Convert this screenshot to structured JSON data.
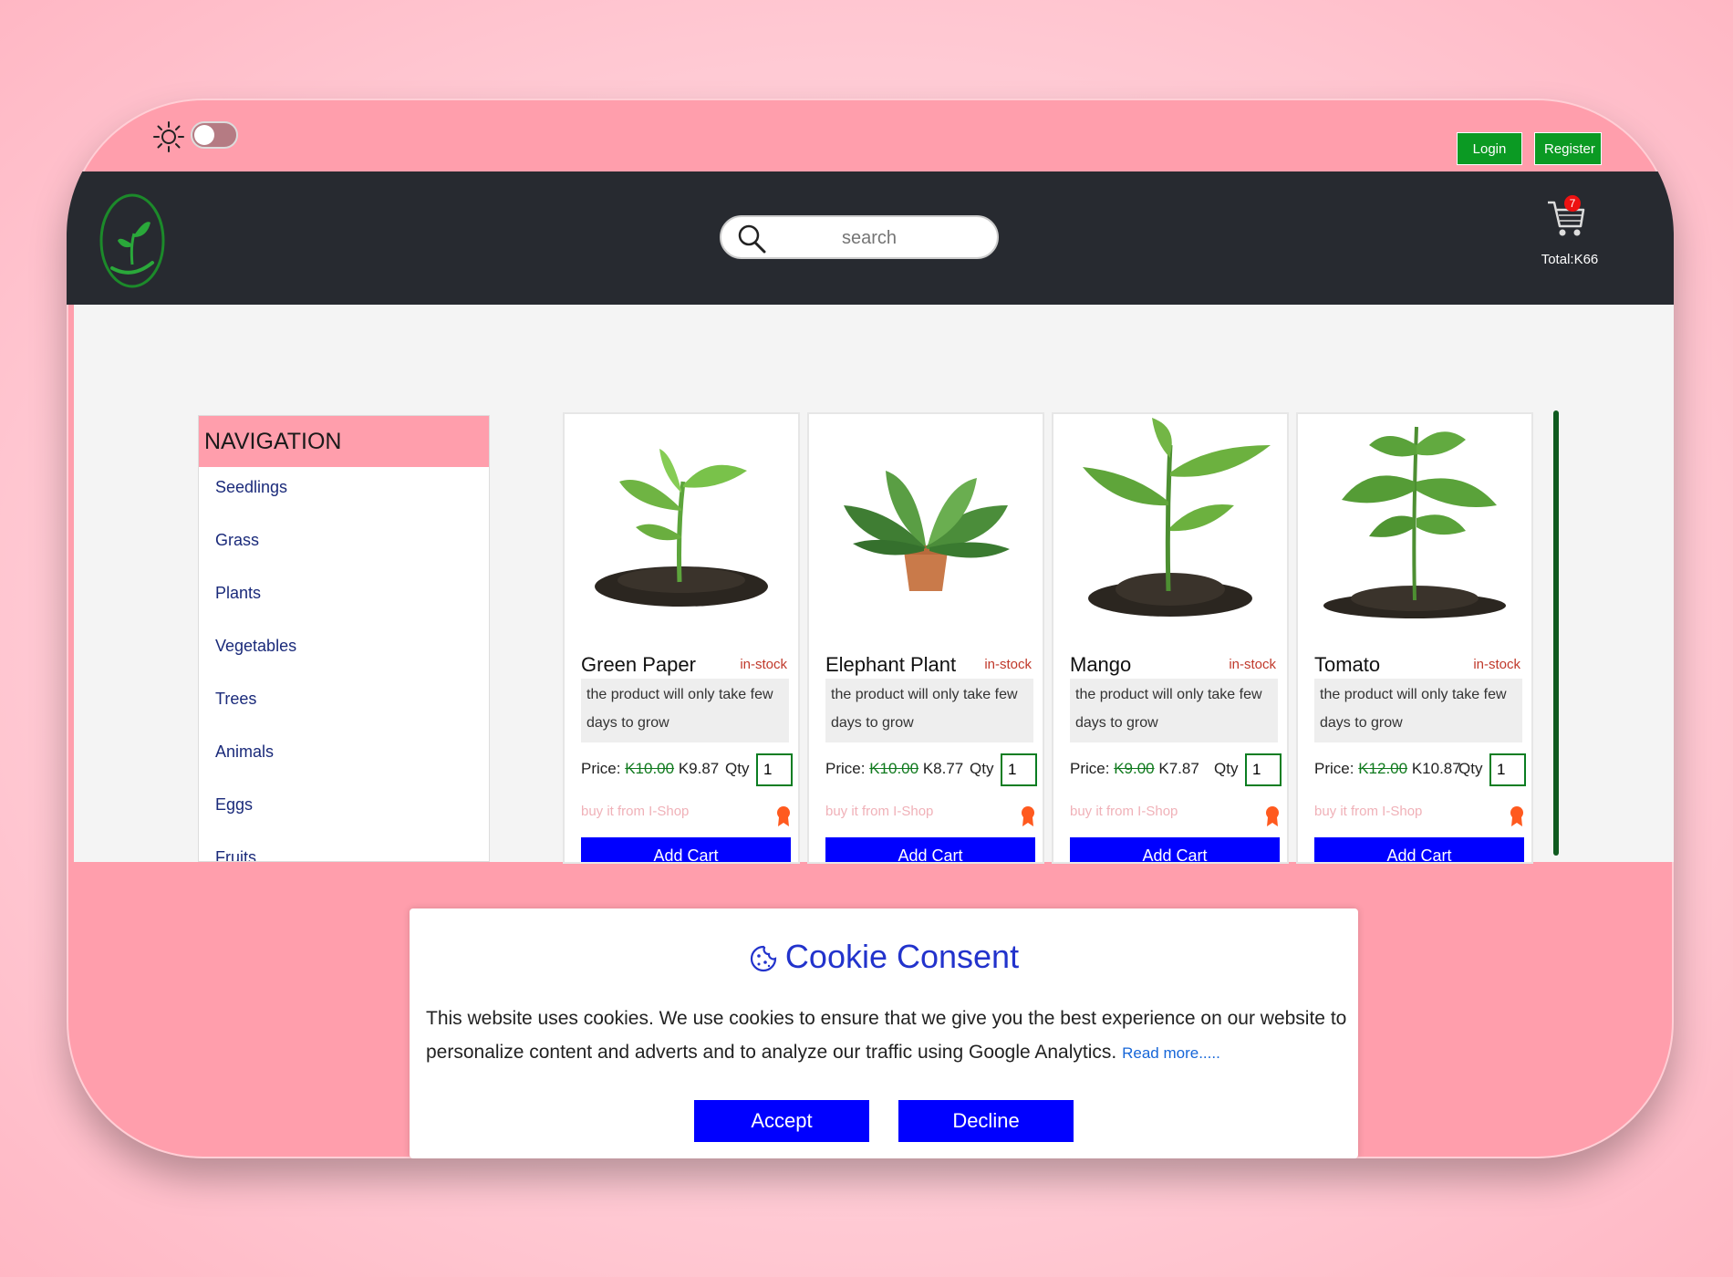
{
  "topbar": {
    "theme_toggle": "light-dark-toggle",
    "login_label": "Login",
    "register_label": "Register"
  },
  "header": {
    "search": {
      "placeholder": "search"
    },
    "cart": {
      "count": "7",
      "total": "Total:K66"
    }
  },
  "navigation": {
    "title": "NAVIGATION",
    "items": [
      "Seedlings",
      "Grass",
      "Plants",
      "Vegetables",
      "Trees",
      "Animals",
      "Eggs",
      "Fruits"
    ]
  },
  "products": [
    {
      "name": "Green Paper",
      "stock": "in-stock",
      "description": "the product will only take few days to grow",
      "price_label": "Price:",
      "old_price": "K10.00",
      "price": "K9.87",
      "qty_label": "Qty",
      "qty": "1",
      "buy_text": "buy it from I-Shop",
      "add_label": "Add Cart"
    },
    {
      "name": "Elephant Plant",
      "stock": "in-stock",
      "description": "the product will only take few days to grow",
      "price_label": "Price:",
      "old_price": "K10.00",
      "price": "K8.77",
      "qty_label": "Qty",
      "qty": "1",
      "buy_text": "buy it from I-Shop",
      "add_label": "Add Cart"
    },
    {
      "name": "Mango",
      "stock": "in-stock",
      "description": "the product will only take few days to grow",
      "price_label": "Price:",
      "old_price": "K9.00",
      "price": "K7.87",
      "qty_label": "Qty",
      "qty": "1",
      "buy_text": "buy it from I-Shop",
      "add_label": "Add Cart"
    },
    {
      "name": "Tomato",
      "stock": "in-stock",
      "description": "the product will only take few days to grow",
      "price_label": "Price:",
      "old_price": "K12.00",
      "price": "K10.87",
      "qty_label": "Qty",
      "qty": "1",
      "buy_text": "buy it from I-Shop",
      "add_label": "Add Cart"
    }
  ],
  "cookie": {
    "title": "Cookie Consent",
    "text": "This website uses cookies. We use cookies to ensure that we give you the best experience on our website to personalize content and adverts and to analyze our traffic using Google Analytics.",
    "read_more": "Read more.....",
    "accept_label": "Accept",
    "decline_label": "Decline"
  },
  "colors": {
    "page_bg": "#ff9eac",
    "header_bg": "#272a30",
    "auth_green": "#0b9a23",
    "button_blue": "#0000ff",
    "stock_red": "#c0392b",
    "cookie_title": "#2233cc"
  }
}
